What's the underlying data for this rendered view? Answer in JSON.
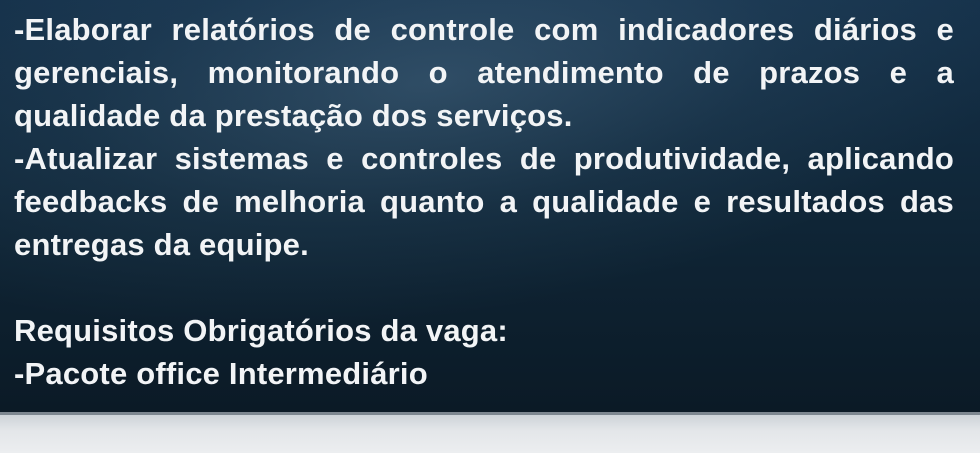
{
  "content": {
    "paragraphs": [
      "-Elaborar relatórios de controle com indicadores diários e gerenciais, monitorando o atendimento de prazos e a qualidade da prestação dos serviços.",
      "-Atualizar sistemas e controles de produtividade, aplicando feedbacks de melhoria quanto a qualidade e resultados das entregas da equipe."
    ],
    "requirements_heading": "Requisitos Obrigatórios da vaga:",
    "requirements": [
      "-Pacote office Intermediário"
    ]
  },
  "colors": {
    "panel_top": "#15314a",
    "panel_bottom": "#0b1a26",
    "text": "#f2f4f6",
    "bottom_strip": "#e3e6e9"
  }
}
